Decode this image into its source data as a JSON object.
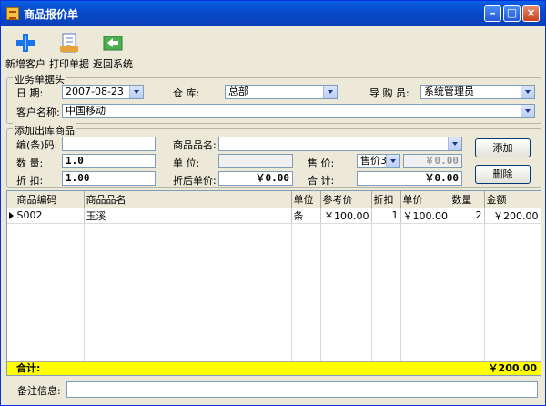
{
  "window": {
    "title": "商品报价单"
  },
  "toolbar": {
    "add_customer": "新增客户",
    "print": "打印单据",
    "back": "返回系统"
  },
  "header_group": {
    "title": "业务单据头",
    "date_label": "日   期:",
    "date_value": "2007-08-23",
    "warehouse_label": "仓   库:",
    "warehouse_value": "总部",
    "buyer_label": "导 购 员:",
    "buyer_value": "系统管理员",
    "customer_label": "客户名称:",
    "customer_value": "中国移动"
  },
  "add_group": {
    "title": "添加出库商品",
    "code_label": "编(条)码:",
    "code_value": "",
    "name_label": "商品品名:",
    "name_value": "",
    "qty_label": "数   量:",
    "qty_value": "1.0",
    "unit_label": "单   位:",
    "unit_value": "",
    "price_label": "售   价:",
    "price_type": "售价3",
    "price_value": "￥0.00",
    "discount_label": "折   扣:",
    "discount_value": "1.00",
    "disc_price_label": "折后单价:",
    "disc_price_value": "￥0.00",
    "total_label": "合   计:",
    "total_value": "￥0.00",
    "add_button": "添加",
    "delete_button": "删除"
  },
  "table": {
    "columns": [
      "商品编码",
      "商品品名",
      "单位",
      "参考价",
      "折扣",
      "单价",
      "数量",
      "金额"
    ],
    "rows": [
      {
        "code": "S002",
        "name": "玉溪",
        "unit": "条",
        "ref_price": "￥100.00",
        "discount": "1",
        "price": "￥100.00",
        "qty": "2",
        "amount": "￥200.00"
      }
    ],
    "total_label": "合计:",
    "total_value": "￥200.00"
  },
  "footer": {
    "remark_label": "备注信息:",
    "remark_value": ""
  }
}
